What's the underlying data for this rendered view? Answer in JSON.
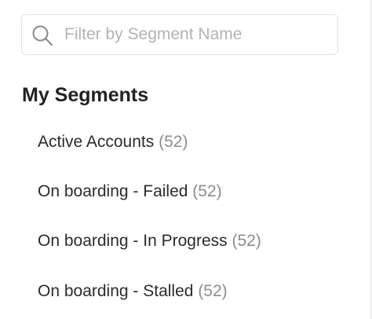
{
  "search": {
    "placeholder": "Filter by Segment Name",
    "icon": "search-icon"
  },
  "section": {
    "title": "My Segments"
  },
  "segments": [
    {
      "label": "Active Accounts",
      "count": "(52)"
    },
    {
      "label": "On boarding - Failed",
      "count": "(52)"
    },
    {
      "label": "On boarding - In Progress",
      "count": "(52)"
    },
    {
      "label": "On boarding - Stalled",
      "count": "(52)"
    }
  ]
}
